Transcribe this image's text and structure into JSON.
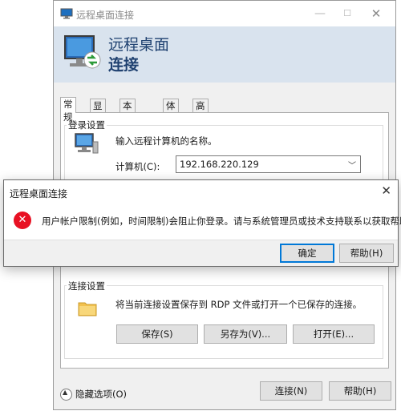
{
  "window": {
    "title": "远程桌面连接",
    "controls": {
      "minimize": "—",
      "maximize": "☐",
      "close": "✕"
    }
  },
  "banner": {
    "line1": "远程桌面",
    "line2": "连接"
  },
  "tabs": [
    {
      "label": "常规",
      "active": true
    },
    {
      "label": "显示",
      "active": false
    },
    {
      "label": "本地资源",
      "active": false
    },
    {
      "label": "体验",
      "active": false
    },
    {
      "label": "高级",
      "active": false
    }
  ],
  "login": {
    "group_label": "登录设置",
    "hint": "输入远程计算机的名称。",
    "computer_label": "计算机(C):",
    "computer_value": "192.168.220.129"
  },
  "connection": {
    "group_label": "连接设置",
    "hint": "将当前连接设置保存到 RDP 文件或打开一个已保存的连接。",
    "save_label": "保存(S)",
    "save_as_label": "另存为(V)...",
    "open_label": "打开(E)..."
  },
  "footer": {
    "hide_options_label": "隐藏选项(O)",
    "connect_label": "连接(N)",
    "help_label": "帮助(H)"
  },
  "error_dialog": {
    "title": "远程桌面连接",
    "message": "用户帐户限制(例如，时间限制)会阻止你登录。请与系统管理员或技术支持联系以获取帮助。",
    "ok_label": "确定",
    "help_label": "帮助(H)",
    "icon": "error-icon"
  },
  "colors": {
    "banner_bg": "#d9e3ee",
    "banner_text": "#1f4170",
    "error_red": "#e81123",
    "focus_blue": "#0078d7"
  }
}
